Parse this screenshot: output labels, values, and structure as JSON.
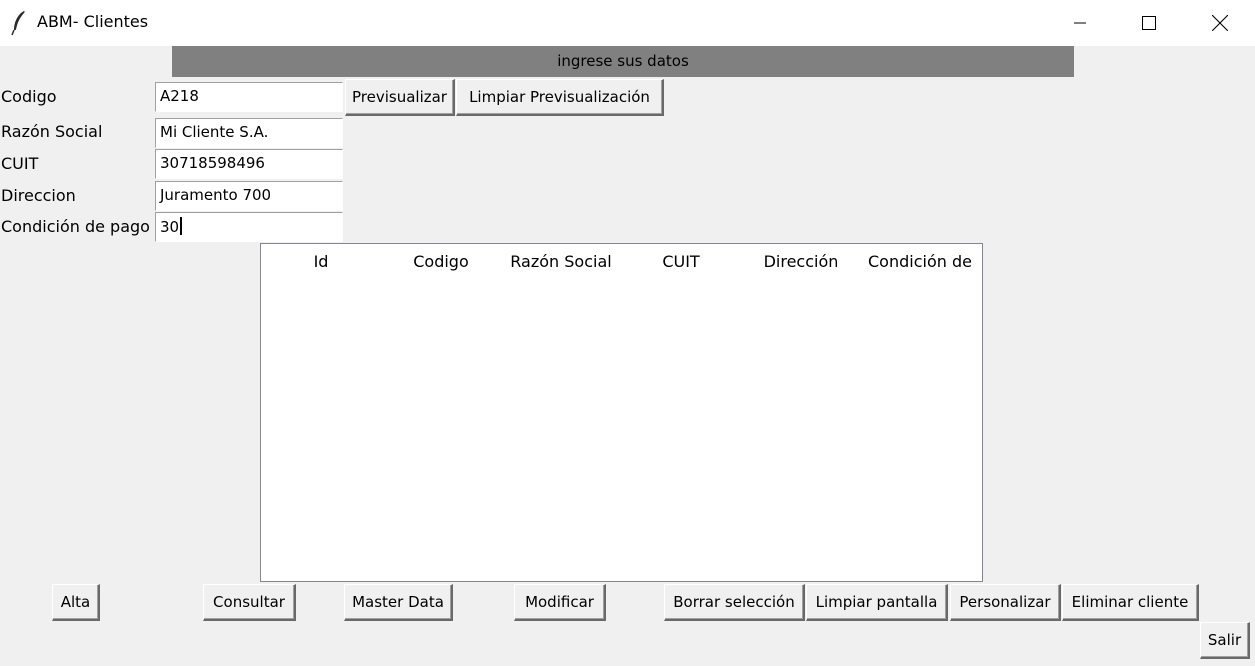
{
  "window": {
    "title": "ABM- Clientes",
    "icon": "feather-icon"
  },
  "banner": {
    "text": "ingrese sus datos"
  },
  "form": {
    "codigo": {
      "label": "Codigo",
      "value": "A218"
    },
    "razon_social": {
      "label": "Razón Social",
      "value": "Mi Cliente S.A."
    },
    "cuit": {
      "label": "CUIT",
      "value": "30718598496"
    },
    "direccion": {
      "label": "Direccion",
      "value": "Juramento 700"
    },
    "condicion_pago": {
      "label": "Condición de pago",
      "value": "30"
    }
  },
  "preview_buttons": {
    "previsualizar": "Previsualizar",
    "limpiar_previsualizacion": "Limpiar Previsualización"
  },
  "table": {
    "columns": [
      "Id",
      "Codigo",
      "Razón Social",
      "CUIT",
      "Dirección",
      "Condición de"
    ],
    "rows": []
  },
  "actions": {
    "alta": "Alta",
    "consultar": "Consultar",
    "master_data": "Master Data",
    "modificar": "Modificar",
    "borrar_seleccion": "Borrar selección",
    "limpiar_pantalla": "Limpiar pantalla",
    "personalizar": "Personalizar",
    "eliminar_cliente": "Eliminar cliente",
    "salir": "Salir"
  },
  "colors": {
    "window_bg": "#f0f0f0",
    "banner_bg": "#808080",
    "titlebar_bg": "#ffffff"
  }
}
